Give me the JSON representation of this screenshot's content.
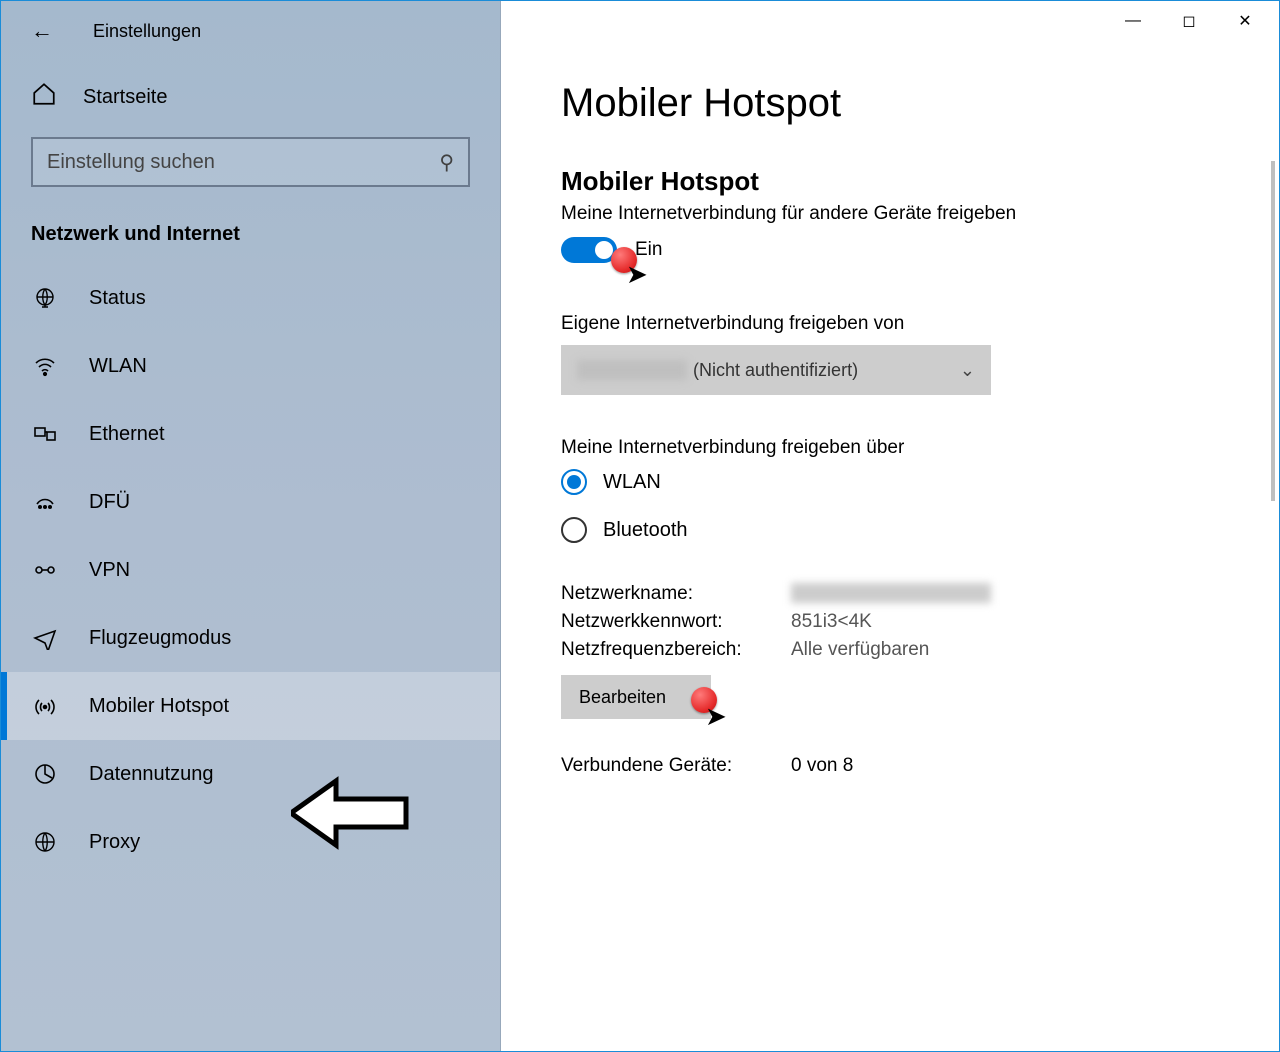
{
  "window": {
    "title": "Einstellungen",
    "home_label": "Startseite",
    "search_placeholder": "Einstellung suchen",
    "category_header": "Netzwerk und Internet"
  },
  "nav": {
    "items": [
      {
        "id": "status",
        "label": "Status"
      },
      {
        "id": "wlan",
        "label": "WLAN"
      },
      {
        "id": "ethernet",
        "label": "Ethernet"
      },
      {
        "id": "dfu",
        "label": "DFÜ"
      },
      {
        "id": "vpn",
        "label": "VPN"
      },
      {
        "id": "flugzeugmodus",
        "label": "Flugzeugmodus"
      },
      {
        "id": "hotspot",
        "label": "Mobiler Hotspot"
      },
      {
        "id": "datennutzung",
        "label": "Datennutzung"
      },
      {
        "id": "proxy",
        "label": "Proxy"
      }
    ],
    "active_index": 6
  },
  "main": {
    "page_title": "Mobiler Hotspot",
    "toggle": {
      "heading": "Mobiler Hotspot",
      "subtitle": "Meine Internetverbindung für andere Geräte freigeben",
      "state_label": "Ein",
      "on": true
    },
    "share_from": {
      "label": "Eigene Internetverbindung freigeben von",
      "selected_suffix": "(Nicht authentifiziert)"
    },
    "share_over": {
      "label": "Meine Internetverbindung freigeben über",
      "options": [
        {
          "label": "WLAN",
          "selected": true
        },
        {
          "label": "Bluetooth",
          "selected": false
        }
      ]
    },
    "props": {
      "name_label": "Netzwerkname:",
      "pass_label": "Netzwerkkennwort:",
      "pass_value": "851i3<4K",
      "band_label": "Netzfrequenzbereich:",
      "band_value": "Alle verfügbaren",
      "edit_label": "Bearbeiten"
    },
    "connected": {
      "label": "Verbundene Geräte:",
      "value": "0 von 8"
    }
  },
  "colors": {
    "accent": "#0078d7"
  }
}
